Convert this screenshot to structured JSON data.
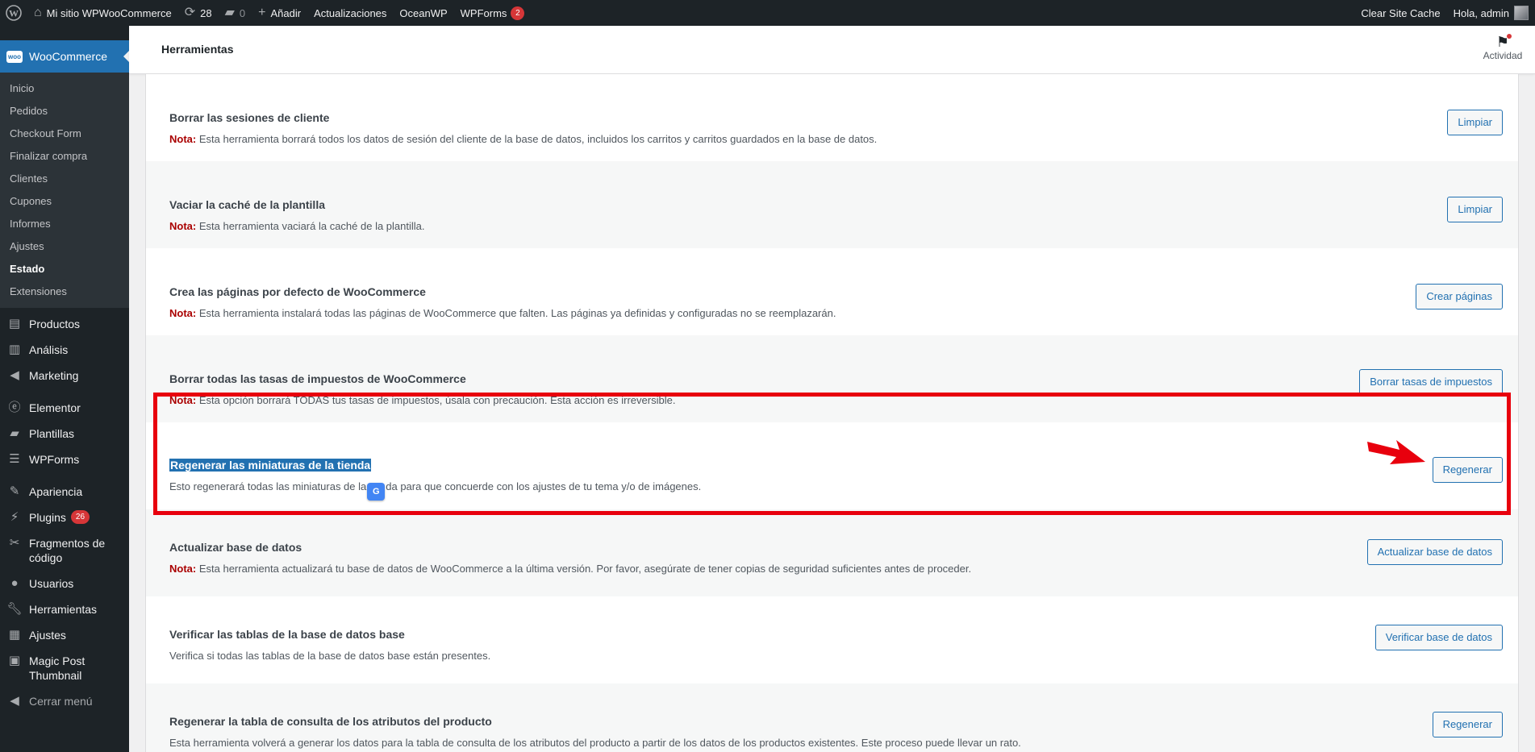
{
  "adminbar": {
    "site_name": "Mi sitio WPWooCommerce",
    "updates_count": "28",
    "comments_count": "0",
    "add_new": "Añadir",
    "updates_label": "Actualizaciones",
    "oceanwp": "OceanWP",
    "wpforms": "WPForms",
    "wpforms_badge": "2",
    "clear_cache": "Clear Site Cache",
    "greeting": "Hola, admin"
  },
  "sidebar": {
    "current": "WooCommerce",
    "woo_logo_text": "woo",
    "submenu": [
      "Inicio",
      "Pedidos",
      "Checkout Form",
      "Finalizar compra",
      "Clientes",
      "Cupones",
      "Informes",
      "Ajustes",
      "Estado",
      "Extensiones"
    ],
    "menu": [
      {
        "label": "Productos",
        "icon": "archive-icon"
      },
      {
        "label": "Análisis",
        "icon": "chart-icon"
      },
      {
        "label": "Marketing",
        "icon": "megaphone-icon"
      },
      {
        "label": "Elementor",
        "icon": "elementor-icon"
      },
      {
        "label": "Plantillas",
        "icon": "folder-icon"
      },
      {
        "label": "WPForms",
        "icon": "form-icon"
      },
      {
        "label": "Apariencia",
        "icon": "brush-icon"
      },
      {
        "label": "Plugins",
        "icon": "plug-icon",
        "badge": "26"
      },
      {
        "label": "Fragmentos de código",
        "icon": "scissors-icon"
      },
      {
        "label": "Usuarios",
        "icon": "user-icon"
      },
      {
        "label": "Herramientas",
        "icon": "wrench-icon"
      },
      {
        "label": "Ajustes",
        "icon": "settings-icon"
      },
      {
        "label": "Magic Post Thumbnail",
        "icon": "image-icon"
      }
    ],
    "collapse": "Cerrar menú"
  },
  "header": {
    "title": "Herramientas",
    "activity": "Actividad"
  },
  "tools": [
    {
      "title": "Borrar las sesiones de cliente",
      "nota": "Nota:",
      "desc": "Esta herramienta borrará todos los datos de sesión del cliente de la base de datos, incluidos los carritos y carritos guardados en la base de datos.",
      "button": "Limpiar"
    },
    {
      "title": "Vaciar la caché de la plantilla",
      "nota": "Nota:",
      "desc": "Esta herramienta vaciará la caché de la plantilla.",
      "button": "Limpiar"
    },
    {
      "title": "Crea las páginas por defecto de WooCommerce",
      "nota": "Nota:",
      "desc": "Esta herramienta instalará todas las páginas de WooCommerce que falten. Las páginas ya definidas y configuradas no se reemplazarán.",
      "button": "Crear páginas"
    },
    {
      "title": "Borrar todas las tasas de impuestos de WooCommerce",
      "nota": "Nota:",
      "desc": "Esta opción borrará TODAS tus tasas de impuestos, úsala con precaución. Esta acción es irreversible.",
      "button": "Borrar tasas de impuestos"
    },
    {
      "title": "Regenerar las miniaturas de la tienda",
      "desc_a": "Esto regenerará todas las miniaturas de la",
      "desc_b": "da para que concuerde con los ajustes de tu tema y/o de imágenes.",
      "button": "Regenerar"
    },
    {
      "title": "Actualizar base de datos",
      "nota": "Nota:",
      "desc": "Esta herramienta actualizará tu base de datos de WooCommerce a la última versión. Por favor, asegúrate de tener copias de seguridad suficientes antes de proceder.",
      "button": "Actualizar base de datos"
    },
    {
      "title": "Verificar las tablas de la base de datos base",
      "desc": "Verifica si todas las tablas de la base de datos base están presentes.",
      "button": "Verificar base de datos"
    },
    {
      "title": "Regenerar la tabla de consulta de los atributos del producto",
      "desc": "Esta herramienta volverá a generar los datos para la tabla de consulta de los atributos del producto a partir de los datos de los productos existentes. Este proceso puede llevar un rato.",
      "button": "Regenerar"
    }
  ],
  "colors": {
    "annotation_red": "#e8000d",
    "wp_blue": "#2271b1",
    "nota_red": "#aa0000"
  }
}
